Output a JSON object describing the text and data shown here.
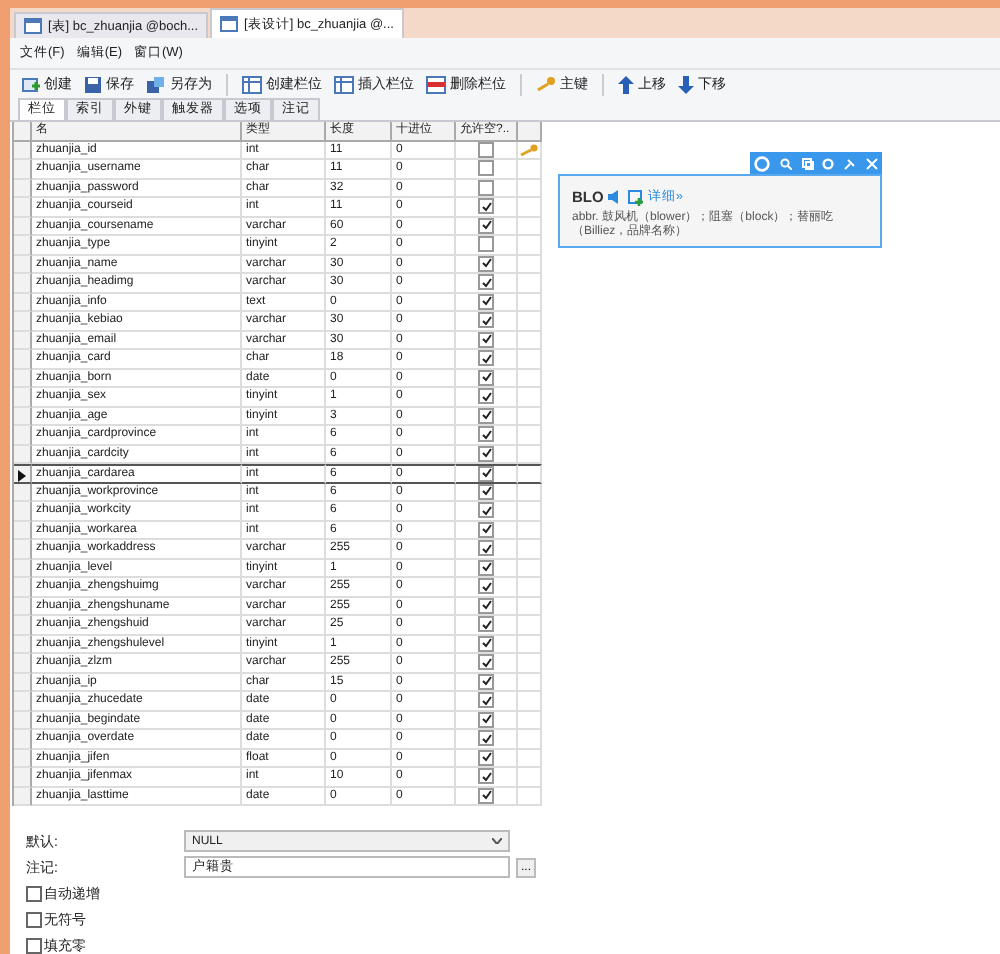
{
  "doc_tabs": [
    {
      "label": "[表] bc_zhuanjia @boch...",
      "selected": false
    },
    {
      "label": "[表设计] bc_zhuanjia @...",
      "selected": true
    }
  ],
  "menu": [
    "文件(F)",
    "编辑(E)",
    "窗口(W)"
  ],
  "toolbar": [
    {
      "kind": "new",
      "label": "创建"
    },
    {
      "kind": "save",
      "label": "保存"
    },
    {
      "kind": "saveas",
      "label": "另存为"
    },
    {
      "kind": "sep"
    },
    {
      "kind": "addcol",
      "label": "创建栏位"
    },
    {
      "kind": "inscol",
      "label": "插入栏位"
    },
    {
      "kind": "delcol",
      "label": "删除栏位"
    },
    {
      "kind": "sep"
    },
    {
      "kind": "key",
      "label": "主键"
    },
    {
      "kind": "sep"
    },
    {
      "kind": "up",
      "label": "上移"
    },
    {
      "kind": "down",
      "label": "下移"
    }
  ],
  "sub_tabs": [
    {
      "label": "栏位",
      "selected": true
    },
    {
      "label": "索引",
      "selected": false
    },
    {
      "label": "外键",
      "selected": false
    },
    {
      "label": "触发器",
      "selected": false
    },
    {
      "label": "选项",
      "selected": false
    },
    {
      "label": "注记",
      "selected": false
    }
  ],
  "table": {
    "columns": [
      "名",
      "类型",
      "长度",
      "十进位",
      "允许空?.."
    ],
    "rows": [
      {
        "name": "zhuanjia_id",
        "type": "int",
        "length": "11",
        "decimal": "0",
        "nullable": false,
        "primary_key": true,
        "selected": false
      },
      {
        "name": "zhuanjia_username",
        "type": "char",
        "length": "11",
        "decimal": "0",
        "nullable": false,
        "primary_key": false,
        "selected": false
      },
      {
        "name": "zhuanjia_password",
        "type": "char",
        "length": "32",
        "decimal": "0",
        "nullable": false,
        "primary_key": false,
        "selected": false
      },
      {
        "name": "zhuanjia_courseid",
        "type": "int",
        "length": "11",
        "decimal": "0",
        "nullable": true,
        "primary_key": false,
        "selected": false
      },
      {
        "name": "zhuanjia_coursename",
        "type": "varchar",
        "length": "60",
        "decimal": "0",
        "nullable": true,
        "primary_key": false,
        "selected": false
      },
      {
        "name": "zhuanjia_type",
        "type": "tinyint",
        "length": "2",
        "decimal": "0",
        "nullable": false,
        "primary_key": false,
        "selected": false
      },
      {
        "name": "zhuanjia_name",
        "type": "varchar",
        "length": "30",
        "decimal": "0",
        "nullable": true,
        "primary_key": false,
        "selected": false
      },
      {
        "name": "zhuanjia_headimg",
        "type": "varchar",
        "length": "30",
        "decimal": "0",
        "nullable": true,
        "primary_key": false,
        "selected": false
      },
      {
        "name": "zhuanjia_info",
        "type": "text",
        "length": "0",
        "decimal": "0",
        "nullable": true,
        "primary_key": false,
        "selected": false
      },
      {
        "name": "zhuanjia_kebiao",
        "type": "varchar",
        "length": "30",
        "decimal": "0",
        "nullable": true,
        "primary_key": false,
        "selected": false
      },
      {
        "name": "zhuanjia_email",
        "type": "varchar",
        "length": "30",
        "decimal": "0",
        "nullable": true,
        "primary_key": false,
        "selected": false
      },
      {
        "name": "zhuanjia_card",
        "type": "char",
        "length": "18",
        "decimal": "0",
        "nullable": true,
        "primary_key": false,
        "selected": false
      },
      {
        "name": "zhuanjia_born",
        "type": "date",
        "length": "0",
        "decimal": "0",
        "nullable": true,
        "primary_key": false,
        "selected": false
      },
      {
        "name": "zhuanjia_sex",
        "type": "tinyint",
        "length": "1",
        "decimal": "0",
        "nullable": true,
        "primary_key": false,
        "selected": false
      },
      {
        "name": "zhuanjia_age",
        "type": "tinyint",
        "length": "3",
        "decimal": "0",
        "nullable": true,
        "primary_key": false,
        "selected": false
      },
      {
        "name": "zhuanjia_cardprovince",
        "type": "int",
        "length": "6",
        "decimal": "0",
        "nullable": true,
        "primary_key": false,
        "selected": false
      },
      {
        "name": "zhuanjia_cardcity",
        "type": "int",
        "length": "6",
        "decimal": "0",
        "nullable": true,
        "primary_key": false,
        "selected": false
      },
      {
        "name": "zhuanjia_cardarea",
        "type": "int",
        "length": "6",
        "decimal": "0",
        "nullable": true,
        "primary_key": false,
        "selected": true
      },
      {
        "name": "zhuanjia_workprovince",
        "type": "int",
        "length": "6",
        "decimal": "0",
        "nullable": true,
        "primary_key": false,
        "selected": false
      },
      {
        "name": "zhuanjia_workcity",
        "type": "int",
        "length": "6",
        "decimal": "0",
        "nullable": true,
        "primary_key": false,
        "selected": false
      },
      {
        "name": "zhuanjia_workarea",
        "type": "int",
        "length": "6",
        "decimal": "0",
        "nullable": true,
        "primary_key": false,
        "selected": false
      },
      {
        "name": "zhuanjia_workaddress",
        "type": "varchar",
        "length": "255",
        "decimal": "0",
        "nullable": true,
        "primary_key": false,
        "selected": false
      },
      {
        "name": "zhuanjia_level",
        "type": "tinyint",
        "length": "1",
        "decimal": "0",
        "nullable": true,
        "primary_key": false,
        "selected": false
      },
      {
        "name": "zhuanjia_zhengshuimg",
        "type": "varchar",
        "length": "255",
        "decimal": "0",
        "nullable": true,
        "primary_key": false,
        "selected": false
      },
      {
        "name": "zhuanjia_zhengshuname",
        "type": "varchar",
        "length": "255",
        "decimal": "0",
        "nullable": true,
        "primary_key": false,
        "selected": false
      },
      {
        "name": "zhuanjia_zhengshuid",
        "type": "varchar",
        "length": "25",
        "decimal": "0",
        "nullable": true,
        "primary_key": false,
        "selected": false
      },
      {
        "name": "zhuanjia_zhengshulevel",
        "type": "tinyint",
        "length": "1",
        "decimal": "0",
        "nullable": true,
        "primary_key": false,
        "selected": false
      },
      {
        "name": "zhuanjia_zlzm",
        "type": "varchar",
        "length": "255",
        "decimal": "0",
        "nullable": true,
        "primary_key": false,
        "selected": false
      },
      {
        "name": "zhuanjia_ip",
        "type": "char",
        "length": "15",
        "decimal": "0",
        "nullable": true,
        "primary_key": false,
        "selected": false
      },
      {
        "name": "zhuanjia_zhucedate",
        "type": "date",
        "length": "0",
        "decimal": "0",
        "nullable": true,
        "primary_key": false,
        "selected": false
      },
      {
        "name": "zhuanjia_begindate",
        "type": "date",
        "length": "0",
        "decimal": "0",
        "nullable": true,
        "primary_key": false,
        "selected": false
      },
      {
        "name": "zhuanjia_overdate",
        "type": "date",
        "length": "0",
        "decimal": "0",
        "nullable": true,
        "primary_key": false,
        "selected": false
      },
      {
        "name": "zhuanjia_jifen",
        "type": "float",
        "length": "0",
        "decimal": "0",
        "nullable": true,
        "primary_key": false,
        "selected": false
      },
      {
        "name": "zhuanjia_jifenmax",
        "type": "int",
        "length": "10",
        "decimal": "0",
        "nullable": true,
        "primary_key": false,
        "selected": false
      },
      {
        "name": "zhuanjia_lasttime",
        "type": "date",
        "length": "0",
        "decimal": "0",
        "nullable": true,
        "primary_key": false,
        "selected": false
      }
    ]
  },
  "properties": {
    "default_label": "默认:",
    "default_value": "NULL",
    "comment_label": "注记:",
    "comment_value": "户籍贵",
    "browse": "...",
    "options": [
      {
        "label": "自动递增",
        "checked": false
      },
      {
        "label": "无符号",
        "checked": false
      },
      {
        "label": "填充零",
        "checked": false
      }
    ]
  },
  "popup": {
    "word": "BLO",
    "details": "详细»",
    "definition": "abbr. 鼓风机（blower）；阻塞（block）；替丽吃（Billiez，品牌名称）"
  }
}
